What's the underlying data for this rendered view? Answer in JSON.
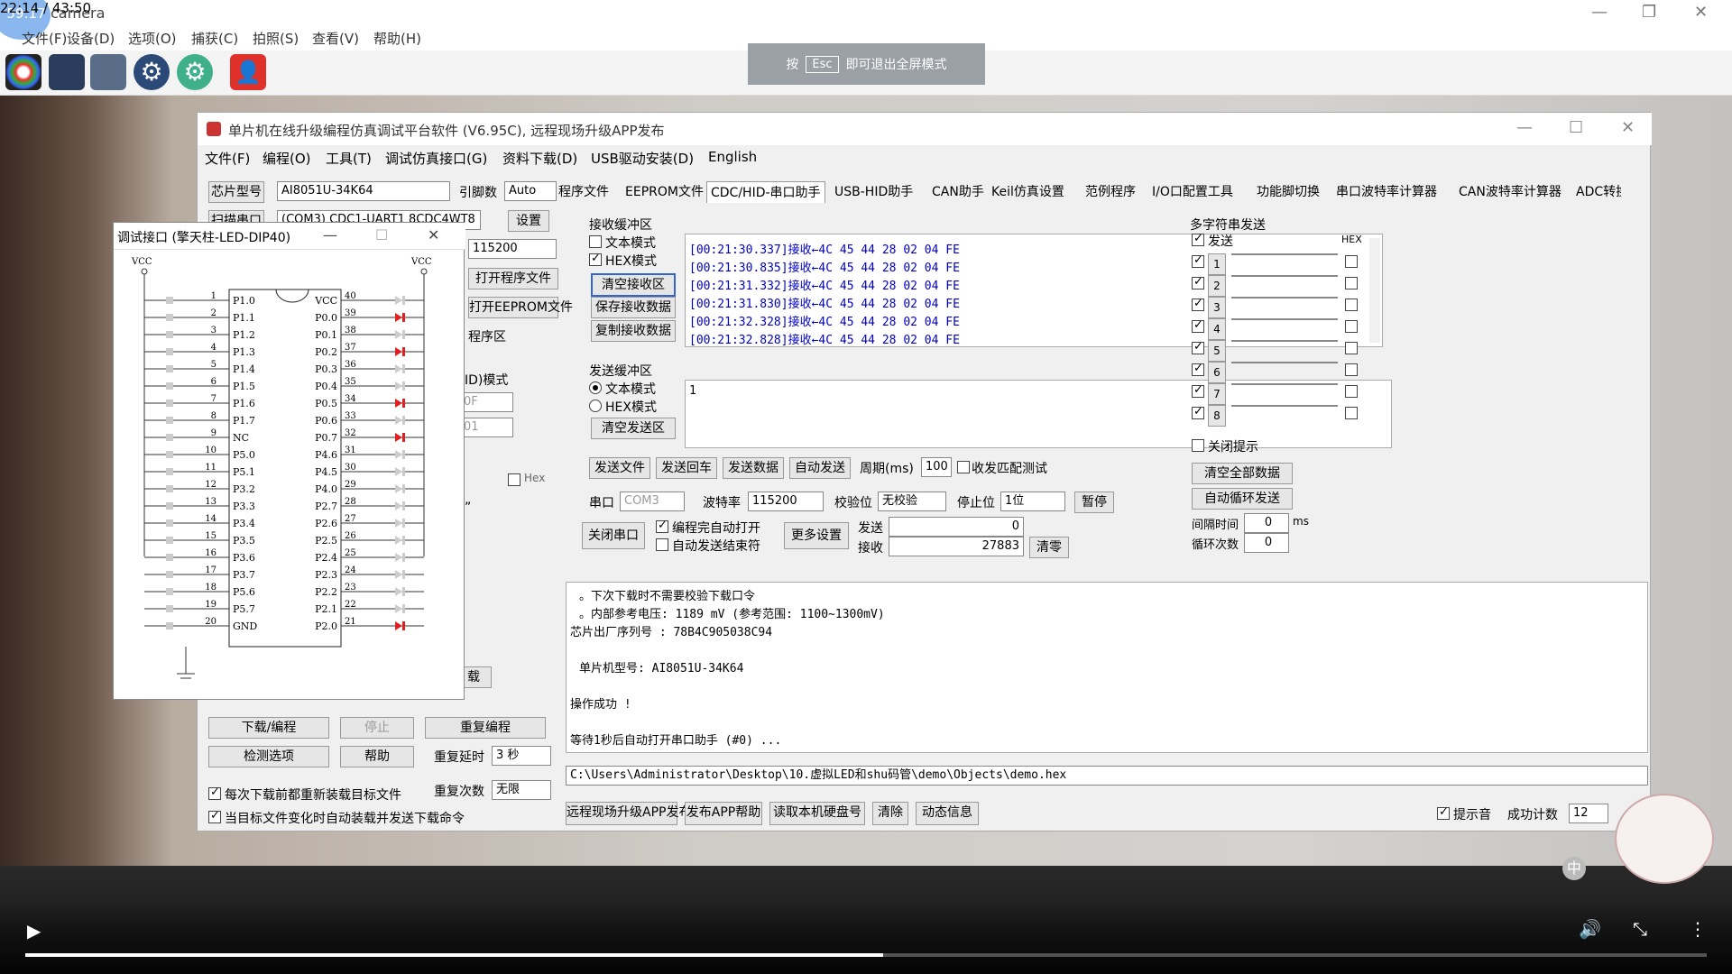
{
  "cam": {
    "badge": "59:17",
    "title": "camera",
    "menu": [
      "文件(F)",
      "设备(D)",
      "选项(O)",
      "捕获(C)",
      "拍照(S)",
      "查看(V)",
      "帮助(H)"
    ]
  },
  "esc": {
    "pre": "按",
    "key": "Esc",
    "post": "即可退出全屏模式"
  },
  "isp": {
    "title": "单片机在线升级编程仿真调试平台软件 (V6.95C), 远程现场升级APP发布",
    "menu": [
      "文件(F)",
      "编程(O)",
      "工具(T)",
      "调试仿真接口(G)",
      "资料下载(D)",
      "USB驱动安装(D)",
      "English"
    ],
    "chip_label": "芯片型号",
    "chip_value": "AI8051U-34K64",
    "pin_label": "引脚数",
    "pin_value": "Auto",
    "scan_label": "扫描串口",
    "port_value": "(COM3) CDC1-UART1 8CDC4WT8",
    "setting": "设置",
    "baud_value": "115200",
    "open_prog": "打开程序文件",
    "open_eeprom": "打开EEPROM文件",
    "prog_area": "程序区",
    "mode_label": "ID)模式",
    "field1": "0F",
    "field2": "01",
    "hex": "Hex",
    "quote": "”",
    "tail_btn": "载",
    "download": "下载/编程",
    "stop": "停止",
    "reprog": "重复编程",
    "check": "检测选项",
    "help": "帮助",
    "delay_label": "重复延时",
    "delay_value": "3 秒",
    "count_label": "重复次数",
    "count_value": "无限",
    "opt1": "每次下载前都重新装载目标文件",
    "opt2": "当目标文件变化时自动装载并发送下载命令",
    "tabs": [
      "程序文件",
      "EEPROM文件",
      "CDC/HID-串口助手",
      "USB-HID助手",
      "CAN助手",
      "Keil仿真设置",
      "范例程序",
      "I/O口配置工具",
      "功能脚切换",
      "串口波特率计算器",
      "CAN波特率计算器",
      "ADC转换"
    ],
    "recv_title": "接收缓冲区",
    "text_mode": "文本模式",
    "hex_mode": "HEX模式",
    "clear_recv": "清空接收区",
    "save_recv": "保存接收数据",
    "copy_recv": "复制接收数据",
    "recv_lines": [
      "[00:21:30.337]接收←4C 45 44 28 02 04 FE",
      "[00:21:30.835]接收←4C 45 44 28 02 04 FE",
      "[00:21:31.332]接收←4C 45 44 28 02 04 FE",
      "[00:21:31.830]接收←4C 45 44 28 02 04 FE",
      "[00:21:32.328]接收←4C 45 44 28 02 04 FE",
      "[00:21:32.828]接收←4C 45 44 28 02 04 FE"
    ],
    "send_title": "发送缓冲区",
    "clear_send": "清空发送区",
    "send_text": "1",
    "send_file": "发送文件",
    "send_enter": "发送回车",
    "send_data": "发送数据",
    "auto_send": "自动发送",
    "period_label": "周期(ms)",
    "period_value": "100",
    "match_label": "收发匹配测试",
    "port_label": "串口",
    "port_short": "COM3",
    "baud_label": "波特率",
    "check_label": "校验位",
    "check_value": "无校验",
    "stop_label": "停止位",
    "stop_value": "1位",
    "pause": "暂停",
    "close_port": "关闭串口",
    "auto_open": "编程完自动打开",
    "auto_end": "自动发送结束符",
    "more": "更多设置",
    "tx_label": "发送",
    "tx_value": "0",
    "rx_label": "接收",
    "rx_value": "27883",
    "clear_count": "清零",
    "multi_title": "多字符串发送",
    "multi_send": "发送",
    "multi_hex": "HEX",
    "multi_rows": [
      "1",
      "2",
      "3",
      "4",
      "5",
      "6",
      "7",
      "8"
    ],
    "close_tip": "关闭提示",
    "clear_all": "清空全部数据",
    "auto_loop": "自动循环发送",
    "interval_label": "间隔时间",
    "interval_value": "0",
    "interval_unit": "ms",
    "loop_label": "循环次数",
    "loop_value": "0",
    "log_lines": [
      "。下次下载时不需要校验下载口令",
      "。内部参考电压: 1189 mV (参考范围: 1100~1300mV)",
      "芯片出厂序列号 : 78B4C905038C94",
      "",
      "单片机型号: AI8051U-34K64",
      "",
      "操作成功 !",
      "",
      "等待1秒后自动打开串口助手 (#0) ..."
    ],
    "path": "C:\\Users\\Administrator\\Desktop\\10.虚拟LED和shu码管\\demo\\Objects\\demo.hex",
    "bottom_btns": [
      "远程现场升级APP发布",
      "发布APP帮助",
      "读取本机硬盘号",
      "清除",
      "动态信息"
    ],
    "tone": "提示音",
    "success_label": "成功计数",
    "success_value": "12"
  },
  "dbg": {
    "title": "调试接口 (擎天柱-LED-DIP40)",
    "vcc": "VCC",
    "left_pins": [
      "P1.0",
      "P1.1",
      "P1.2",
      "P1.3",
      "P1.4",
      "P1.5",
      "P1.6",
      "P1.7",
      "NC",
      "P5.0",
      "P5.1",
      "P3.2",
      "P3.3",
      "P3.4",
      "P3.5",
      "P3.6",
      "P3.7",
      "P5.6",
      "P5.7",
      "GND"
    ],
    "right_pins": [
      "VCC",
      "P0.0",
      "P0.1",
      "P0.2",
      "P0.3",
      "P0.4",
      "P0.5",
      "P0.6",
      "P0.7",
      "P4.6",
      "P4.5",
      "P4.0",
      "P2.7",
      "P2.6",
      "P2.5",
      "P2.4",
      "P2.3",
      "P2.2",
      "P2.1",
      "P2.0"
    ],
    "left_nums": [
      "1",
      "2",
      "3",
      "4",
      "5",
      "6",
      "7",
      "8",
      "9",
      "10",
      "11",
      "12",
      "13",
      "14",
      "15",
      "16",
      "17",
      "18",
      "19",
      "20"
    ],
    "right_nums": [
      "40",
      "39",
      "38",
      "37",
      "36",
      "35",
      "34",
      "33",
      "32",
      "31",
      "30",
      "29",
      "28",
      "27",
      "26",
      "25",
      "24",
      "23",
      "22",
      "21"
    ],
    "red_leds": [
      "P0.0",
      "P0.2",
      "P0.5",
      "P0.7",
      "P2.0"
    ]
  },
  "player": {
    "time": "22:14 / 43:50",
    "progress": 0.51
  }
}
